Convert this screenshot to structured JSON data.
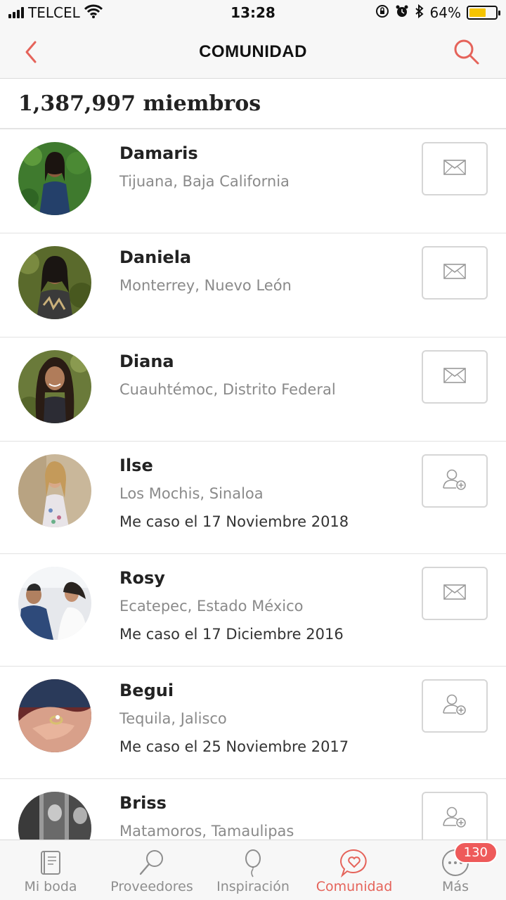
{
  "status_bar": {
    "carrier": "TELCEL",
    "time": "13:28",
    "battery_percent": "64%",
    "battery_level": 0.64,
    "icons": [
      "signal-icon",
      "wifi-icon",
      "rotation-lock-icon",
      "alarm-icon",
      "bluetooth-icon",
      "battery-icon"
    ]
  },
  "nav": {
    "title": "COMUNIDAD",
    "back_icon": "chevron-left-icon",
    "search_icon": "search-icon"
  },
  "header": {
    "member_count": "1,387,997 miembros"
  },
  "members": [
    {
      "name": "Damaris",
      "location": "Tijuana, Baja California",
      "action_icon": "mail-icon"
    },
    {
      "name": "Daniela",
      "location": "Monterrey, Nuevo León",
      "action_icon": "mail-icon"
    },
    {
      "name": "Diana",
      "location": "Cuauhtémoc, Distrito Federal",
      "action_icon": "mail-icon"
    },
    {
      "name": "Ilse",
      "location": "Los Mochis, Sinaloa",
      "date": "Me caso el 17 Noviembre 2018",
      "action_icon": "add-friend-icon"
    },
    {
      "name": "Rosy",
      "location": "Ecatepec, Estado México",
      "date": "Me caso el 17 Diciembre 2016",
      "action_icon": "mail-icon"
    },
    {
      "name": "Begui",
      "location": "Tequila, Jalisco",
      "date": "Me caso el 25 Noviembre 2017",
      "action_icon": "add-friend-icon"
    },
    {
      "name": "Briss",
      "location": "Matamoros, Tamaulipas",
      "action_icon": "add-friend-icon"
    }
  ],
  "tabs": [
    {
      "label": "Mi boda",
      "icon": "notebook-icon"
    },
    {
      "label": "Proveedores",
      "icon": "search-icon"
    },
    {
      "label": "Inspiración",
      "icon": "balloon-icon"
    },
    {
      "label": "Comunidad",
      "icon": "heart-chat-icon",
      "active": true
    },
    {
      "label": "Más",
      "icon": "more-dots-icon",
      "badge": "130"
    }
  ],
  "colors": {
    "accent": "#e5635a",
    "badge": "#ee5a5a",
    "battery": "#f5c400"
  }
}
